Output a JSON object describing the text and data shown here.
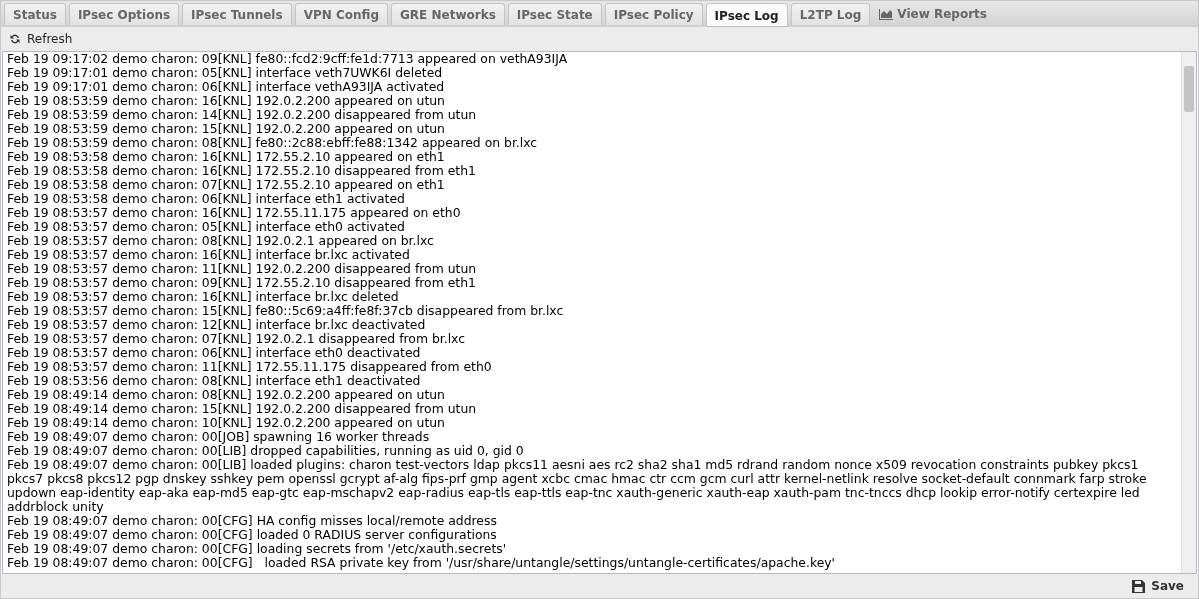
{
  "tabs": [
    {
      "label": "Status",
      "selected": false,
      "kind": "text"
    },
    {
      "label": "IPsec Options",
      "selected": false,
      "kind": "text"
    },
    {
      "label": "IPsec Tunnels",
      "selected": false,
      "kind": "text"
    },
    {
      "label": "VPN Config",
      "selected": false,
      "kind": "text"
    },
    {
      "label": "GRE Networks",
      "selected": false,
      "kind": "text"
    },
    {
      "label": "IPsec State",
      "selected": false,
      "kind": "text"
    },
    {
      "label": "IPsec Policy",
      "selected": false,
      "kind": "text"
    },
    {
      "label": "IPsec Log",
      "selected": true,
      "kind": "text"
    },
    {
      "label": "L2TP Log",
      "selected": false,
      "kind": "text"
    },
    {
      "label": "View Reports",
      "selected": false,
      "kind": "link"
    }
  ],
  "toolbar": {
    "refresh": "Refresh"
  },
  "log_lines": [
    "Feb 19 09:17:02 demo charon: 09[KNL] fe80::fcd2:9cff:fe1d:7713 appeared on vethA93IJA",
    "Feb 19 09:17:01 demo charon: 05[KNL] interface veth7UWK6I deleted",
    "Feb 19 09:17:01 demo charon: 06[KNL] interface vethA93IJA activated",
    "Feb 19 08:53:59 demo charon: 16[KNL] 192.0.2.200 appeared on utun",
    "Feb 19 08:53:59 demo charon: 14[KNL] 192.0.2.200 disappeared from utun",
    "Feb 19 08:53:59 demo charon: 15[KNL] 192.0.2.200 appeared on utun",
    "Feb 19 08:53:59 demo charon: 08[KNL] fe80::2c88:ebff:fe88:1342 appeared on br.lxc",
    "Feb 19 08:53:58 demo charon: 16[KNL] 172.55.2.10 appeared on eth1",
    "Feb 19 08:53:58 demo charon: 16[KNL] 172.55.2.10 disappeared from eth1",
    "Feb 19 08:53:58 demo charon: 07[KNL] 172.55.2.10 appeared on eth1",
    "Feb 19 08:53:58 demo charon: 06[KNL] interface eth1 activated",
    "Feb 19 08:53:57 demo charon: 16[KNL] 172.55.11.175 appeared on eth0",
    "Feb 19 08:53:57 demo charon: 05[KNL] interface eth0 activated",
    "Feb 19 08:53:57 demo charon: 08[KNL] 192.0.2.1 appeared on br.lxc",
    "Feb 19 08:53:57 demo charon: 16[KNL] interface br.lxc activated",
    "Feb 19 08:53:57 demo charon: 11[KNL] 192.0.2.200 disappeared from utun",
    "Feb 19 08:53:57 demo charon: 09[KNL] 172.55.2.10 disappeared from eth1",
    "Feb 19 08:53:57 demo charon: 16[KNL] interface br.lxc deleted",
    "Feb 19 08:53:57 demo charon: 15[KNL] fe80::5c69:a4ff:fe8f:37cb disappeared from br.lxc",
    "Feb 19 08:53:57 demo charon: 12[KNL] interface br.lxc deactivated",
    "Feb 19 08:53:57 demo charon: 07[KNL] 192.0.2.1 disappeared from br.lxc",
    "Feb 19 08:53:57 demo charon: 06[KNL] interface eth0 deactivated",
    "Feb 19 08:53:57 demo charon: 11[KNL] 172.55.11.175 disappeared from eth0",
    "Feb 19 08:53:56 demo charon: 08[KNL] interface eth1 deactivated",
    "Feb 19 08:49:14 demo charon: 08[KNL] 192.0.2.200 appeared on utun",
    "Feb 19 08:49:14 demo charon: 15[KNL] 192.0.2.200 disappeared from utun",
    "Feb 19 08:49:14 demo charon: 10[KNL] 192.0.2.200 appeared on utun",
    "Feb 19 08:49:07 demo charon: 00[JOB] spawning 16 worker threads",
    "Feb 19 08:49:07 demo charon: 00[LIB] dropped capabilities, running as uid 0, gid 0",
    "Feb 19 08:49:07 demo charon: 00[LIB] loaded plugins: charon test-vectors ldap pkcs11 aesni aes rc2 sha2 sha1 md5 rdrand random nonce x509 revocation constraints pubkey pkcs1 pkcs7 pkcs8 pkcs12 pgp dnskey sshkey pem openssl gcrypt af-alg fips-prf gmp agent xcbc cmac hmac ctr ccm gcm curl attr kernel-netlink resolve socket-default connmark farp stroke updown eap-identity eap-aka eap-md5 eap-gtc eap-mschapv2 eap-radius eap-tls eap-ttls eap-tnc xauth-generic xauth-eap xauth-pam tnc-tnccs dhcp lookip error-notify certexpire led addrblock unity",
    "Feb 19 08:49:07 demo charon: 00[CFG] HA config misses local/remote address",
    "Feb 19 08:49:07 demo charon: 00[CFG] loaded 0 RADIUS server configurations",
    "Feb 19 08:49:07 demo charon: 00[CFG] loading secrets from '/etc/xauth.secrets'",
    "Feb 19 08:49:07 demo charon: 00[CFG]   loaded RSA private key from '/usr/share/untangle/settings/untangle-certificates/apache.key'"
  ],
  "footer": {
    "save": "Save"
  }
}
